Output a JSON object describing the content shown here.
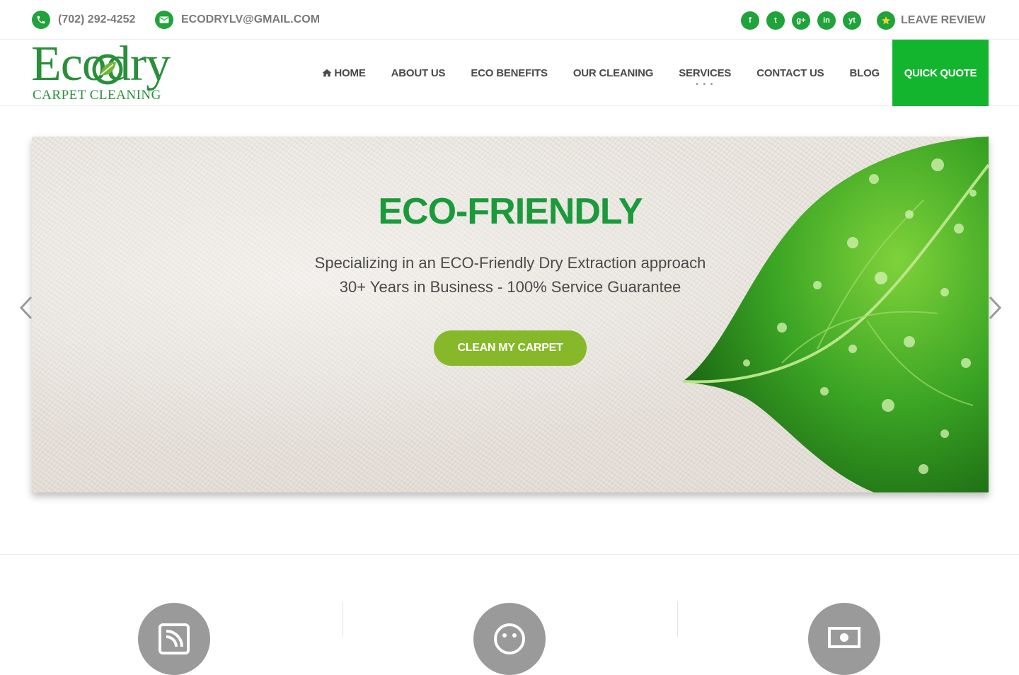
{
  "topbar": {
    "phone": "(702) 292-4252",
    "email": "ECODRYLV@GMAIL.COM",
    "social": [
      "f",
      "t",
      "g+",
      "in",
      "yt"
    ],
    "review": "LEAVE REVIEW"
  },
  "brand": {
    "name": "Ecodry",
    "tagline": "CARPET CLEANING",
    "color": "#2a8f3b"
  },
  "nav": {
    "items": [
      "HOME",
      "ABOUT US",
      "ECO BENEFITS",
      "OUR CLEANING",
      "SERVICES",
      "CONTACT US",
      "BLOG"
    ],
    "services_more": "• • •",
    "quote": "QUICK QUOTE"
  },
  "hero": {
    "title": "ECO-FRIENDLY",
    "line1": "Specializing in an ECO-Friendly Dry Extraction approach",
    "line2": "30+ Years in Business - 100% Service Guarantee",
    "button": "CLEAN MY CARPET"
  },
  "colors": {
    "accent": "#13b52f",
    "button": "#86b82a",
    "title": "#1b9a3b"
  }
}
